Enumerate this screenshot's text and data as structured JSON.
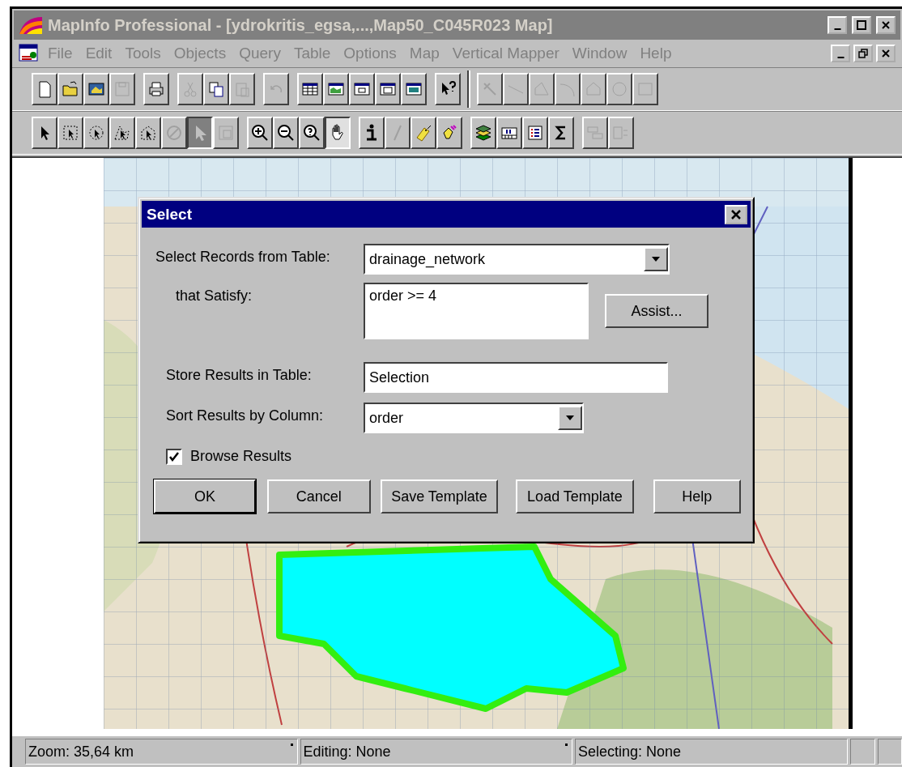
{
  "window": {
    "title": "MapInfo Professional - [ydrokritis_egsa,...,Map50_C045R023 Map]"
  },
  "menu": [
    "File",
    "Edit",
    "Tools",
    "Objects",
    "Query",
    "Table",
    "Options",
    "Map",
    "Vertical Mapper",
    "Window",
    "Help"
  ],
  "toolbars": [
    {
      "buttons": [
        {
          "disabled": false,
          "pressed": false
        },
        {
          "disabled": false,
          "pressed": false
        },
        {
          "disabled": false,
          "pressed": false
        },
        {
          "disabled": true,
          "pressed": false
        },
        {
          "disabled": false,
          "pressed": false
        },
        {
          "disabled": true,
          "pressed": false
        },
        {
          "disabled": false,
          "pressed": false
        },
        {
          "disabled": true,
          "pressed": false
        },
        {
          "disabled": true,
          "pressed": false
        },
        {
          "disabled": false,
          "pressed": false
        },
        {
          "disabled": false,
          "pressed": false
        },
        {
          "disabled": false,
          "pressed": false
        },
        {
          "disabled": false,
          "pressed": false
        },
        {
          "disabled": false,
          "pressed": false
        },
        {
          "disabled": false,
          "pressed": false
        },
        {
          "disabled": true,
          "pressed": false
        },
        {
          "disabled": true,
          "pressed": false
        },
        {
          "disabled": true,
          "pressed": false
        },
        {
          "disabled": true,
          "pressed": false
        },
        {
          "disabled": true,
          "pressed": false
        },
        {
          "disabled": true,
          "pressed": false
        },
        {
          "disabled": true,
          "pressed": false
        }
      ]
    },
    {
      "buttons": [
        {
          "disabled": false,
          "pressed": false
        },
        {
          "disabled": false,
          "pressed": false
        },
        {
          "disabled": false,
          "pressed": false
        },
        {
          "disabled": false,
          "pressed": false
        },
        {
          "disabled": false,
          "pressed": false
        },
        {
          "disabled": true,
          "pressed": false
        },
        {
          "disabled": true,
          "pressed": true
        },
        {
          "disabled": true,
          "pressed": false
        },
        {
          "disabled": false,
          "pressed": false
        },
        {
          "disabled": false,
          "pressed": false
        },
        {
          "disabled": false,
          "pressed": false
        },
        {
          "disabled": false,
          "pressed": true
        },
        {
          "disabled": false,
          "pressed": false
        },
        {
          "disabled": true,
          "pressed": false
        },
        {
          "disabled": false,
          "pressed": false
        },
        {
          "disabled": false,
          "pressed": false
        },
        {
          "disabled": false,
          "pressed": false
        },
        {
          "disabled": false,
          "pressed": false
        },
        {
          "disabled": false,
          "pressed": false
        },
        {
          "disabled": false,
          "pressed": false
        },
        {
          "disabled": true,
          "pressed": false
        },
        {
          "disabled": true,
          "pressed": false
        }
      ]
    }
  ],
  "dialog": {
    "title": "Select",
    "fields": [
      {
        "kind": "dropdown",
        "label": "Select Records from Table:",
        "value": "drainage_network"
      },
      {
        "kind": "textarea",
        "label": "that Satisfy:",
        "value": "order >= 4"
      },
      {
        "kind": "text",
        "label": "Store Results in Table:",
        "value": "Selection"
      },
      {
        "kind": "dropdown",
        "label": "Sort Results by Column:",
        "value": "order"
      }
    ],
    "assist_button": "Assist...",
    "checkbox": {
      "label": "Browse Results",
      "checked": true
    },
    "buttons": [
      {
        "label": "OK",
        "default": true
      },
      {
        "label": "Cancel",
        "default": false
      },
      {
        "label": "Save Template",
        "default": false
      },
      {
        "label": "Load Template",
        "default": false
      },
      {
        "label": "Help",
        "default": false
      }
    ]
  },
  "status_bar": [
    {
      "text": "Zoom: 35,64 km",
      "marker": true
    },
    {
      "text": "Editing: None",
      "marker": true
    },
    {
      "text": "Selecting: None",
      "marker": false
    }
  ]
}
